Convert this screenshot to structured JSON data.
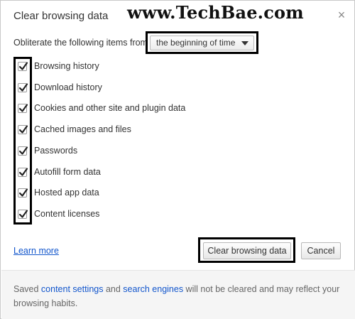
{
  "dialog": {
    "title": "Clear browsing data",
    "watermark": "www.TechBae.com",
    "close_glyph": "×"
  },
  "range": {
    "label": "Obliterate the following items from",
    "selected": "the beginning of time"
  },
  "items": [
    {
      "label": "Browsing history",
      "checked": true
    },
    {
      "label": "Download history",
      "checked": true
    },
    {
      "label": "Cookies and other site and plugin data",
      "checked": true
    },
    {
      "label": "Cached images and files",
      "checked": true
    },
    {
      "label": "Passwords",
      "checked": true
    },
    {
      "label": "Autofill form data",
      "checked": true
    },
    {
      "label": "Hosted app data",
      "checked": true
    },
    {
      "label": "Content licenses",
      "checked": true
    }
  ],
  "actions": {
    "learn_more": "Learn more",
    "clear": "Clear browsing data",
    "cancel": "Cancel"
  },
  "footer": {
    "pre": "Saved ",
    "link1": "content settings",
    "mid": " and ",
    "link2": "search engines",
    "post": " will not be cleared and may reflect your browsing habits."
  },
  "colors": {
    "link": "#1155cc",
    "highlight_box": "#000000",
    "footer_bg": "#f5f5f5"
  }
}
